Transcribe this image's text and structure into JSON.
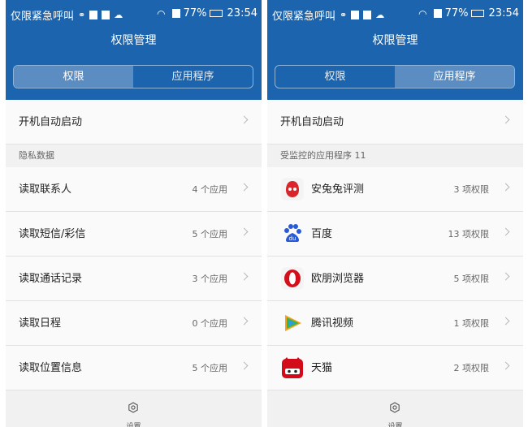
{
  "left": {
    "status": {
      "left_text": "仅限紧急呼叫",
      "battery": "77%",
      "time": "23:54"
    },
    "title": "权限管理",
    "tabs": [
      {
        "label": "权限",
        "selected": true
      },
      {
        "label": "应用程序",
        "selected": false
      }
    ],
    "top_item": {
      "label": "开机自动启动"
    },
    "section": "隐私数据",
    "items": [
      {
        "label": "读取联系人",
        "count": "4 个应用"
      },
      {
        "label": "读取短信/彩信",
        "count": "5 个应用"
      },
      {
        "label": "读取通话记录",
        "count": "3 个应用"
      },
      {
        "label": "读取日程",
        "count": "0 个应用"
      },
      {
        "label": "读取位置信息",
        "count": "5 个应用"
      }
    ],
    "bottom": {
      "label": "设置",
      "icon": "gear-icon"
    }
  },
  "right": {
    "status": {
      "left_text": "仅限紧急呼叫",
      "battery": "77%",
      "time": "23:54"
    },
    "title": "权限管理",
    "tabs": [
      {
        "label": "权限",
        "selected": false
      },
      {
        "label": "应用程序",
        "selected": true
      }
    ],
    "top_item": {
      "label": "开机自动启动"
    },
    "section": "受监控的应用程序 11",
    "apps": [
      {
        "label": "安兔兔评测",
        "count": "3 项权限",
        "icon": "antutu-icon",
        "color": "#d8262a"
      },
      {
        "label": "百度",
        "count": "13 项权限",
        "icon": "baidu-icon",
        "color": "#2a5bd7"
      },
      {
        "label": "欧朋浏览器",
        "count": "5 项权限",
        "icon": "opera-icon",
        "color": "#d40f1b"
      },
      {
        "label": "腾讯视频",
        "count": "1 项权限",
        "icon": "tencent-video-icon",
        "color": "#2b9de4"
      },
      {
        "label": "天猫",
        "count": "2 项权限",
        "icon": "tmall-icon",
        "color": "#d20a1a"
      }
    ],
    "bottom": {
      "label": "设置",
      "icon": "gear-icon"
    }
  },
  "colors": {
    "header": "#1c64ad",
    "tab_selected": "#5b8dc2",
    "background": "#f1f1f1"
  }
}
